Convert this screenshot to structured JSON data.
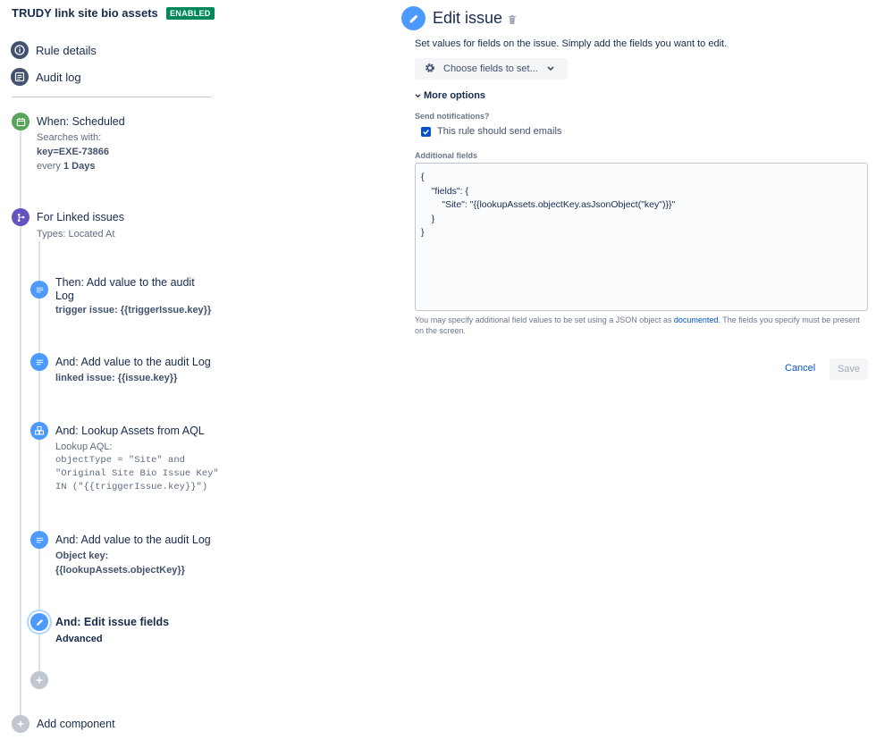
{
  "sidebar": {
    "rule_title": "TRUDY link site bio assets",
    "status_badge": "ENABLED",
    "nav": [
      {
        "label": "Rule details",
        "icon": "info-icon"
      },
      {
        "label": "Audit log",
        "icon": "audit-log-icon"
      }
    ]
  },
  "flow": {
    "trigger": {
      "title": "When: Scheduled",
      "searches_label": "Searches with:",
      "jql": "key=EXE-73866",
      "every_prefix": "every",
      "every_value": "1 Days",
      "icon": "calendar-icon"
    },
    "branch": {
      "title": "For Linked issues",
      "types": "Types: Located At",
      "icon": "branch-icon"
    },
    "actions": [
      {
        "title_line1": "Then: Add value to the audit",
        "title_line2": "Log",
        "detail": "trigger issue: {{triggerIssue.key}}",
        "icon": "log-icon"
      },
      {
        "title": "And: Add value to the audit Log",
        "detail": "linked issue: {{issue.key}}",
        "icon": "log-icon"
      },
      {
        "title": "And: Lookup Assets from AQL",
        "sub": "Lookup AQL:",
        "code_lines": [
          "objectType = \"Site\" and",
          "\"Original Site Bio Issue Key\"",
          "IN (\"{{triggerIssue.key}}\")"
        ],
        "icon": "assets-icon"
      },
      {
        "title": "And: Add value to the audit Log",
        "detail_line1": "Object key:",
        "detail_line2": "{{lookupAssets.objectKey}}",
        "icon": "log-icon"
      },
      {
        "title": "And: Edit issue fields",
        "detail": "Advanced",
        "icon": "pencil-icon"
      }
    ],
    "add_component": "Add component"
  },
  "editor": {
    "title": "Edit issue",
    "description": "Set values for fields on the issue. Simply add the fields you want to edit.",
    "choose_fields": "Choose fields to set...",
    "more_options": "More options",
    "send_notifications_label": "Send notifications?",
    "send_emails_label": "This rule should send emails",
    "send_emails_checked": true,
    "additional_fields_label": "Additional fields",
    "additional_fields_value": "{\n    \"fields\": {\n        \"Site\": \"{{lookupAssets.objectKey.asJsonObject(\"key\")}}\"\n    }\n}",
    "help_prefix": "You may specify additional field values to be set using a JSON object as ",
    "help_link": "documented",
    "help_suffix": ". The fields you specify must be present on the screen.",
    "cancel": "Cancel",
    "save": "Save"
  },
  "colors": {
    "badge_green": "#00875a",
    "primary_blue": "#0052cc",
    "action_icon_blue": "#4c9aff",
    "trigger_green": "#57a55a",
    "branch_purple": "#6554c0"
  }
}
